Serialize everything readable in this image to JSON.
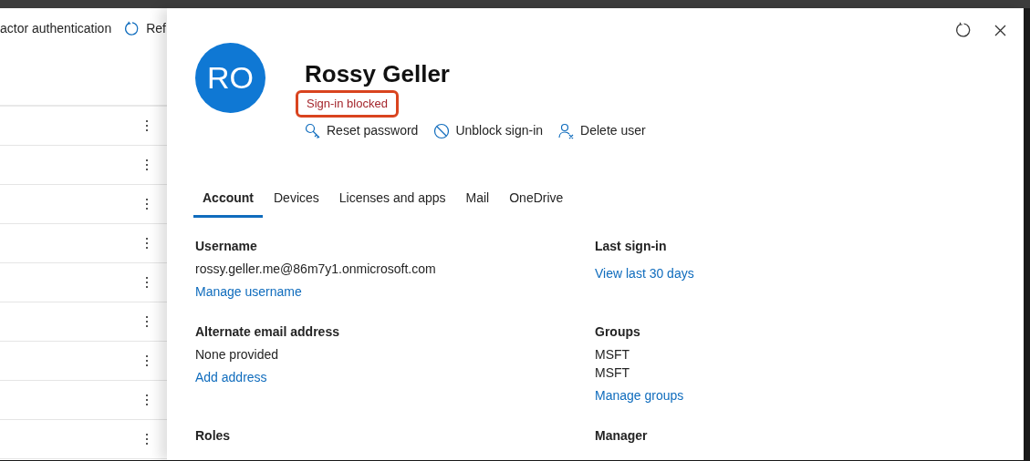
{
  "background_page": {
    "toolbar": [
      {
        "kind": "text",
        "label": "actor authentication"
      },
      {
        "kind": "refresh",
        "label": "Ref"
      }
    ]
  },
  "panel": {
    "avatar_initials": "RO",
    "name": "Rossy Geller",
    "status": {
      "label": "Sign-in blocked",
      "highlighted": true
    },
    "actions": [
      {
        "kind": "key",
        "label": "Reset password"
      },
      {
        "kind": "block",
        "label": "Unblock sign-in"
      },
      {
        "kind": "delete-user",
        "label": "Delete user"
      }
    ],
    "tabs": [
      {
        "label": "Account",
        "selected": true
      },
      {
        "label": "Devices",
        "selected": false
      },
      {
        "label": "Licenses and apps",
        "selected": false
      },
      {
        "label": "Mail",
        "selected": false
      },
      {
        "label": "OneDrive",
        "selected": false
      }
    ],
    "left_fields": [
      {
        "label": "Username",
        "values": [
          "rossy.geller.me@86m7y1.onmicrosoft.com"
        ],
        "link": "Manage username"
      },
      {
        "label": "Alternate email address",
        "values": [
          "None provided"
        ],
        "link": "Add address"
      },
      {
        "label": "Roles"
      }
    ],
    "right_fields": [
      {
        "label": "Last sign-in",
        "link": "View last 30 days"
      },
      {
        "label": "Groups",
        "values": [
          "MSFT",
          "MSFT"
        ],
        "link": "Manage groups"
      },
      {
        "label": "Manager"
      }
    ]
  }
}
